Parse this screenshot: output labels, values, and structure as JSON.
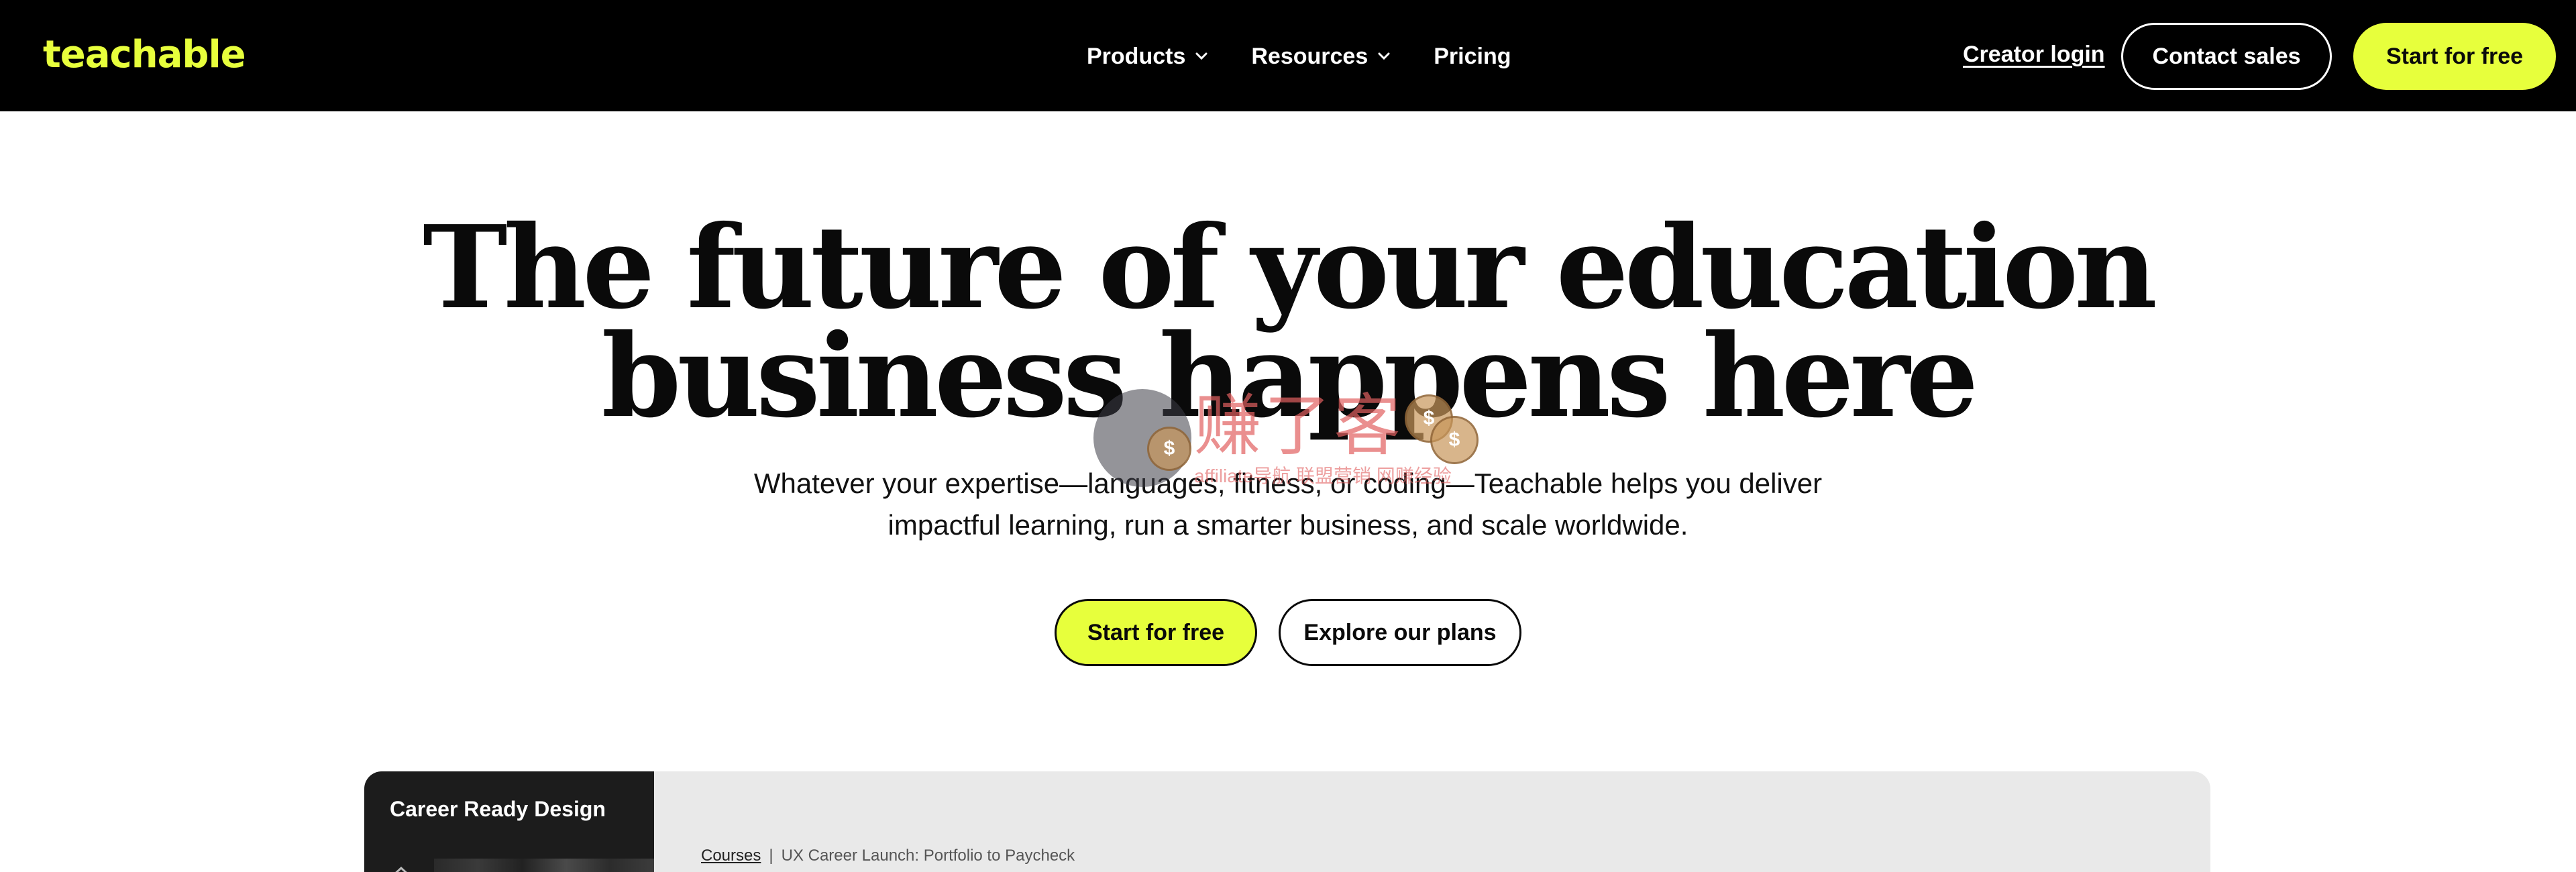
{
  "brand": {
    "logo_text": "teachable",
    "accent_color": "#e7ff3c",
    "nav_bg": "#000000"
  },
  "nav": {
    "items": [
      {
        "label": "Products",
        "has_dropdown": true
      },
      {
        "label": "Resources",
        "has_dropdown": true
      },
      {
        "label": "Pricing",
        "has_dropdown": false
      }
    ],
    "creator_login": "Creator login",
    "contact_sales": "Contact sales",
    "start_free": "Start for free"
  },
  "hero": {
    "title_line1": "The future of your education",
    "title_line2": "business happens here",
    "subtitle_line1": "Whatever your expertise—languages, fitness, or coding—Teachable helps you deliver",
    "subtitle_line2": "impactful learning, run a smarter business, and scale worldwide.",
    "cta_primary": "Start for free",
    "cta_secondary": "Explore our plans"
  },
  "watermark": {
    "text": "赚了客",
    "subtext": "affiliate导航 联盟营销 网赚经验"
  },
  "preview": {
    "course_title": "Career Ready Design",
    "breadcrumb_link": "Courses",
    "breadcrumb_current": "UX Career Launch: Portfolio to Paycheck"
  }
}
